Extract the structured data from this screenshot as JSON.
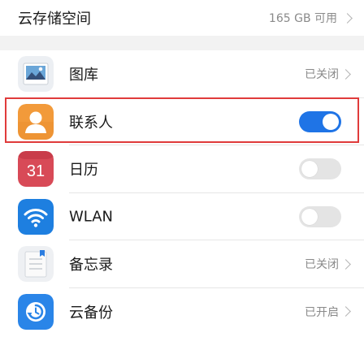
{
  "storage": {
    "title": "云存储空间",
    "value": "165 GB 可用"
  },
  "items": [
    {
      "label": "图库",
      "status": "已关闭",
      "icon": "gallery-icon"
    },
    {
      "label": "联系人",
      "toggle": "on",
      "icon": "contacts-icon"
    },
    {
      "label": "日历",
      "toggle": "off",
      "icon": "calendar-icon",
      "icon_text": "31"
    },
    {
      "label": "WLAN",
      "toggle": "off",
      "icon": "wifi-icon"
    },
    {
      "label": "备忘录",
      "status": "已关闭",
      "icon": "notepad-icon"
    },
    {
      "label": "云备份",
      "status": "已开启",
      "icon": "cloud-backup-icon"
    }
  ],
  "colors": {
    "accent": "#1f74e6",
    "highlight_border": "#e03b3b"
  }
}
